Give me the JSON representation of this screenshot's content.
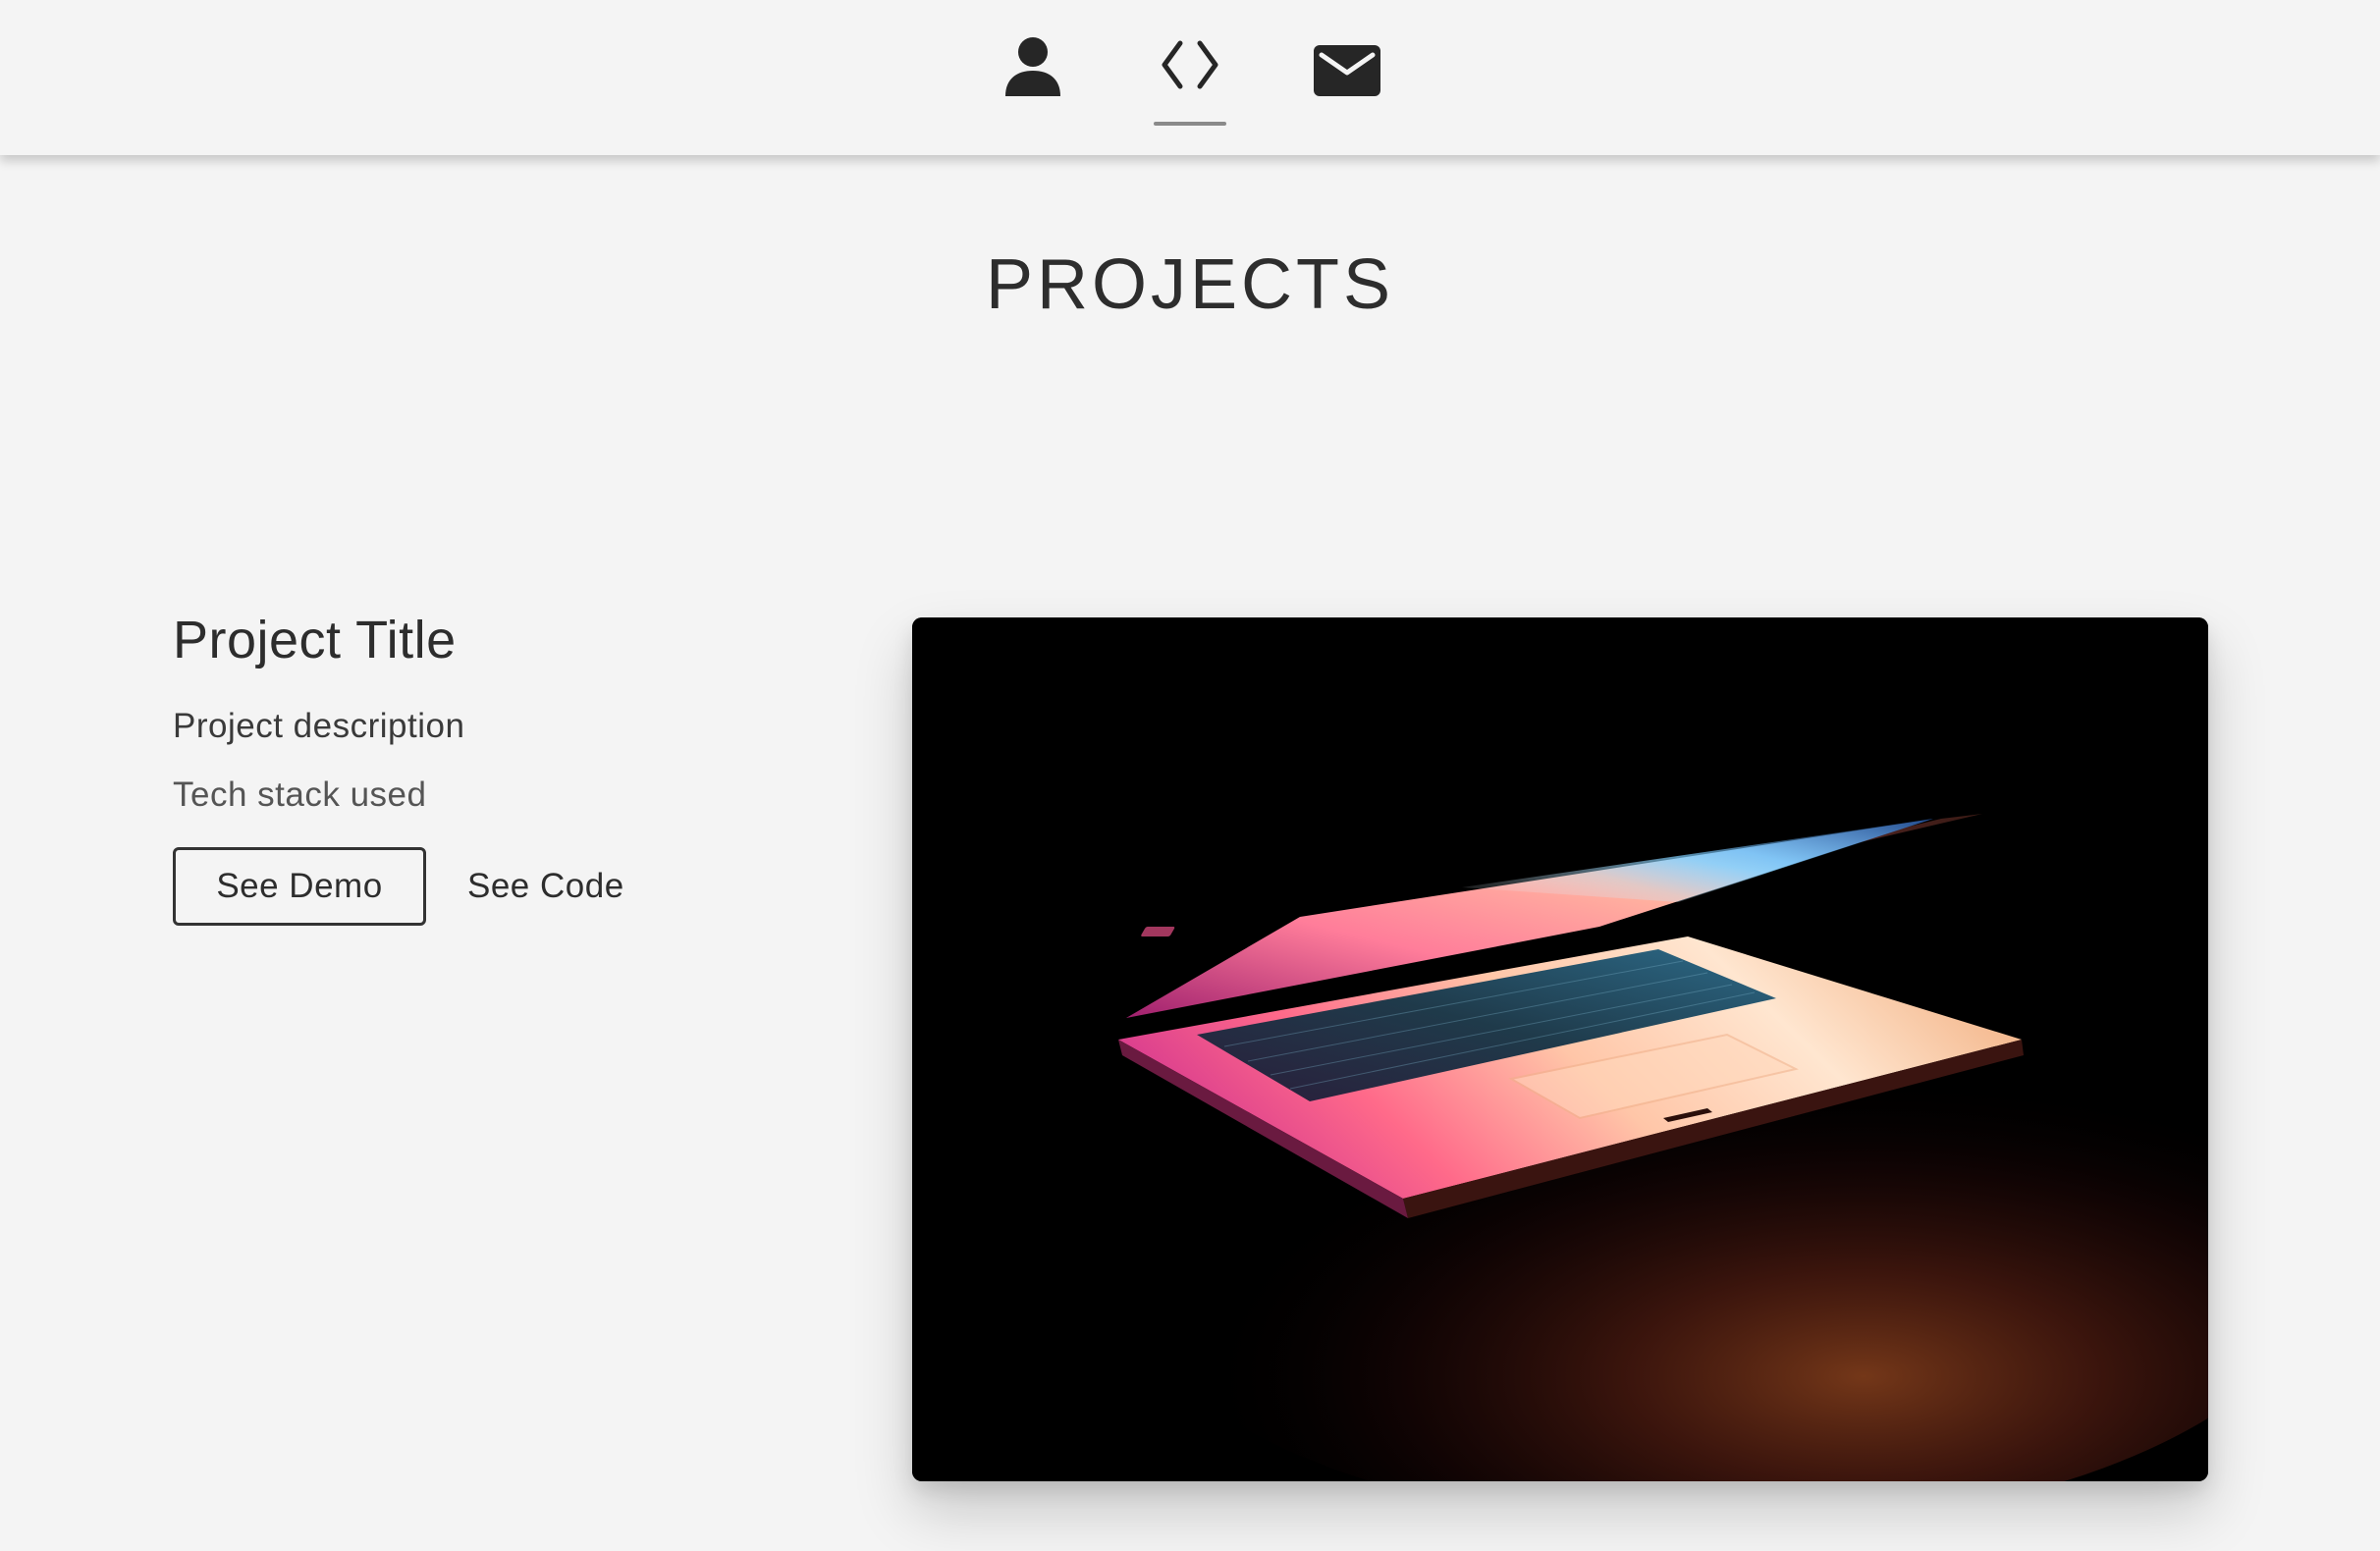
{
  "nav": {
    "items": [
      {
        "icon": "person-icon",
        "label": "About"
      },
      {
        "icon": "code-icon",
        "label": "Projects",
        "active": true
      },
      {
        "icon": "mail-icon",
        "label": "Contact"
      }
    ]
  },
  "section": {
    "title": "PROJECTS"
  },
  "project": {
    "title": "Project Title",
    "description": "Project description",
    "tech_stack": "Tech stack used",
    "demo_label": "See Demo",
    "code_label": "See Code",
    "image_subject": "laptop-photo"
  },
  "colors": {
    "background": "#f4f4f4",
    "text": "#2d2d2d",
    "nav_underline": "#8a8a8a"
  }
}
